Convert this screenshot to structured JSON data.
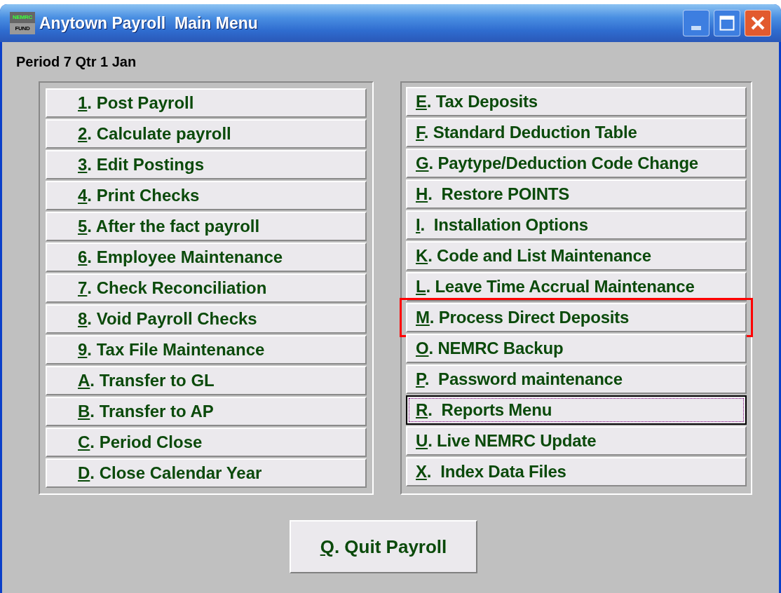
{
  "window": {
    "title": "Anytown Payroll  Main Menu",
    "logo_top": "NEMRC",
    "logo_bottom": "FUND"
  },
  "period": "Period 7 Qtr 1 Jan",
  "left_menu": [
    {
      "key": "1",
      "text": ". Post Payroll",
      "focused": false,
      "highlighted": false
    },
    {
      "key": "2",
      "text": ". Calculate payroll",
      "focused": false,
      "highlighted": false
    },
    {
      "key": "3",
      "text": ". Edit Postings",
      "focused": false,
      "highlighted": false
    },
    {
      "key": "4",
      "text": ". Print Checks",
      "focused": false,
      "highlighted": false
    },
    {
      "key": "5",
      "text": ". After the fact payroll",
      "focused": false,
      "highlighted": false
    },
    {
      "key": "6",
      "text": ". Employee Maintenance",
      "focused": false,
      "highlighted": false
    },
    {
      "key": "7",
      "text": ". Check Reconciliation",
      "focused": false,
      "highlighted": false
    },
    {
      "key": "8",
      "text": ". Void Payroll Checks",
      "focused": false,
      "highlighted": false
    },
    {
      "key": "9",
      "text": ". Tax File Maintenance",
      "focused": false,
      "highlighted": false
    },
    {
      "key": "A",
      "text": ". Transfer to GL",
      "focused": false,
      "highlighted": false
    },
    {
      "key": "B",
      "text": ". Transfer to AP",
      "focused": false,
      "highlighted": false
    },
    {
      "key": "C",
      "text": ". Period Close",
      "focused": false,
      "highlighted": false
    },
    {
      "key": "D",
      "text": ". Close Calendar Year",
      "focused": false,
      "highlighted": false
    }
  ],
  "right_menu": [
    {
      "key": "E",
      "text": ". Tax Deposits",
      "focused": false,
      "highlighted": false
    },
    {
      "key": "F",
      "text": ". Standard Deduction Table",
      "focused": false,
      "highlighted": false
    },
    {
      "key": "G",
      "text": ". Paytype/Deduction Code Change",
      "focused": false,
      "highlighted": false
    },
    {
      "key": "H",
      "text": ".  Restore POINTS",
      "focused": false,
      "highlighted": false
    },
    {
      "key": "I",
      "text": ".  Installation Options",
      "focused": false,
      "highlighted": false
    },
    {
      "key": "K",
      "text": ". Code and List Maintenance",
      "focused": false,
      "highlighted": false
    },
    {
      "key": "L",
      "text": ". Leave Time Accrual Maintenance",
      "focused": false,
      "highlighted": false
    },
    {
      "key": "M",
      "text": ". Process Direct Deposits",
      "focused": false,
      "highlighted": true
    },
    {
      "key": "O",
      "text": ". NEMRC Backup",
      "focused": false,
      "highlighted": false
    },
    {
      "key": "P",
      "text": ".  Password maintenance",
      "focused": false,
      "highlighted": false
    },
    {
      "key": "R",
      "text": ".  Reports Menu",
      "focused": true,
      "highlighted": false
    },
    {
      "key": "U",
      "text": ". Live NEMRC Update",
      "focused": false,
      "highlighted": false
    },
    {
      "key": "X",
      "text": ".  Index Data Files",
      "focused": false,
      "highlighted": false
    }
  ],
  "quit_button": {
    "key": "Q",
    "text": ". Quit Payroll"
  }
}
